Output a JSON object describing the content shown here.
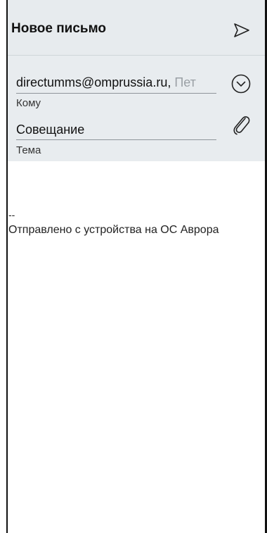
{
  "header": {
    "title": "Новое письмо",
    "send_icon": "send-icon"
  },
  "compose": {
    "to_value": "directumms@omprussia.ru,",
    "to_overflow": " Пет",
    "to_label": "Кому",
    "expand_icon": "chevron-down-circle-icon",
    "subject_value": "Совещание",
    "subject_label": "Тема",
    "attach_icon": "paperclip-icon"
  },
  "body": {
    "signature_separator": "--",
    "signature_text": "Отправлено с устройства на ОС Аврора"
  },
  "colors": {
    "header_bg": "#e7ebee",
    "compose_bg": "#e8ecef",
    "text": "#111111",
    "muted_text": "#9aa0a5"
  }
}
